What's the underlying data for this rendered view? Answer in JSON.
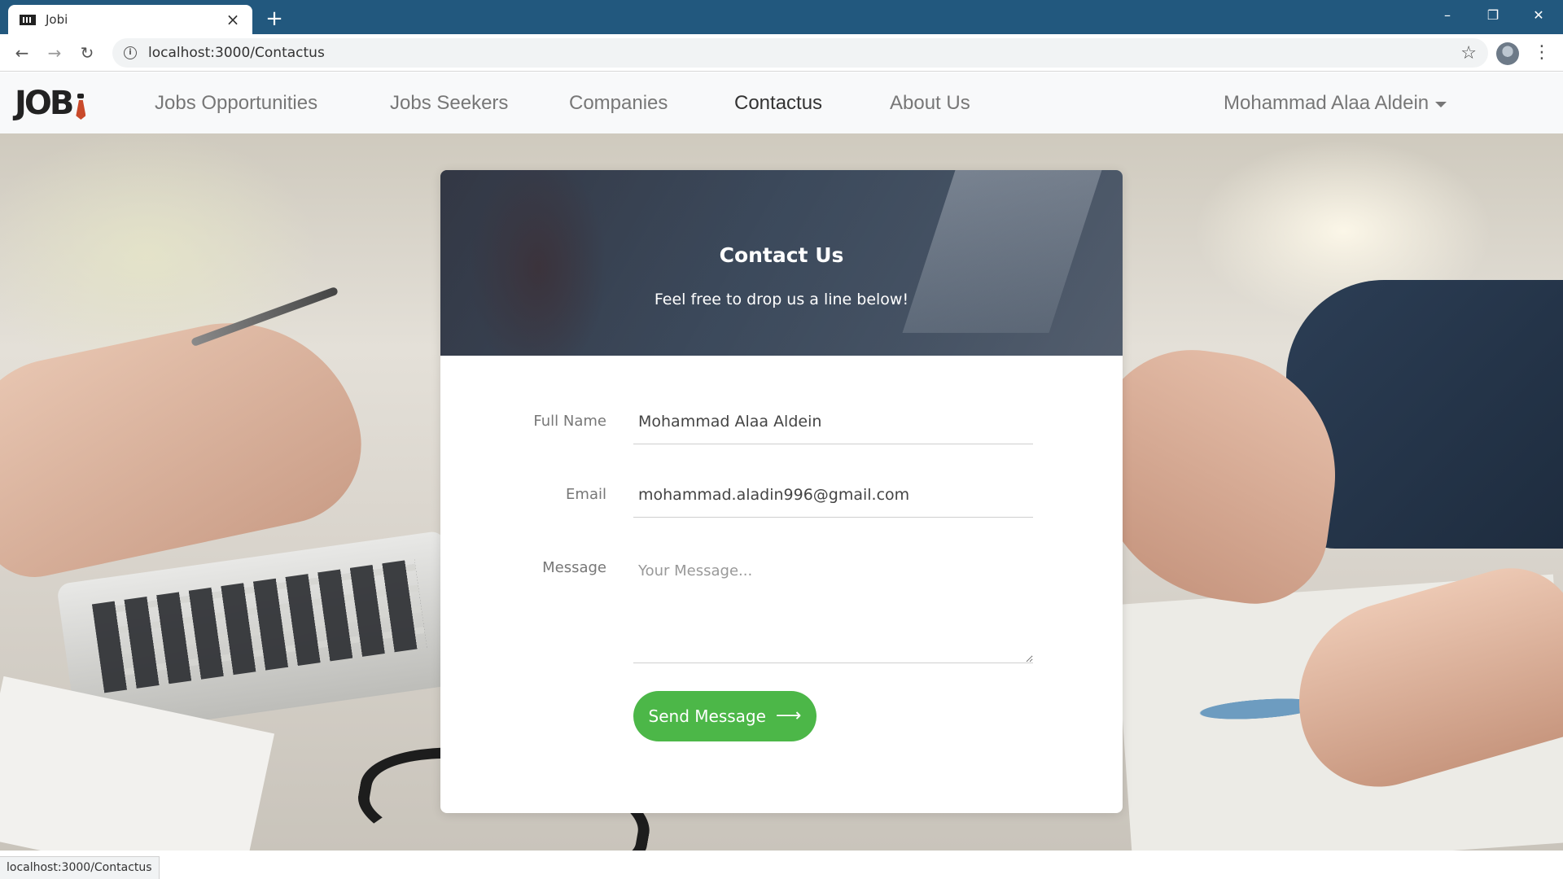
{
  "browser": {
    "tab_title": "Jobi",
    "tab_close": "×",
    "new_tab": "+",
    "url": "localhost:3000/Contactus",
    "status_url": "localhost:3000/Contactus",
    "window_controls": {
      "minimize": "–",
      "restore": "❐",
      "close": "✕"
    },
    "nav": {
      "back": "←",
      "forward": "→",
      "reload": "↻",
      "star": "☆",
      "menu": "⋮"
    }
  },
  "site": {
    "logo": "JOB",
    "nav": {
      "jobs_opportunities": "Jobs Opportunities",
      "jobs_seekers": "Jobs Seekers",
      "companies": "Companies",
      "contactus": "Contactus",
      "about_us": "About Us"
    },
    "user": "Mohammad Alaa Aldein"
  },
  "contact": {
    "title": "Contact Us",
    "subtitle": "Feel free to drop us a line below!",
    "full_name_label": "Full Name",
    "full_name_value": "Mohammad Alaa Aldein",
    "email_label": "Email",
    "email_value": "mohammad.aladin996@gmail.com",
    "message_label": "Message",
    "message_placeholder": "Your Message...",
    "send_label": "Send Message",
    "send_arrow": "⟶"
  },
  "colors": {
    "titlebar": "#22587e",
    "accent_green": "#4cb748"
  }
}
